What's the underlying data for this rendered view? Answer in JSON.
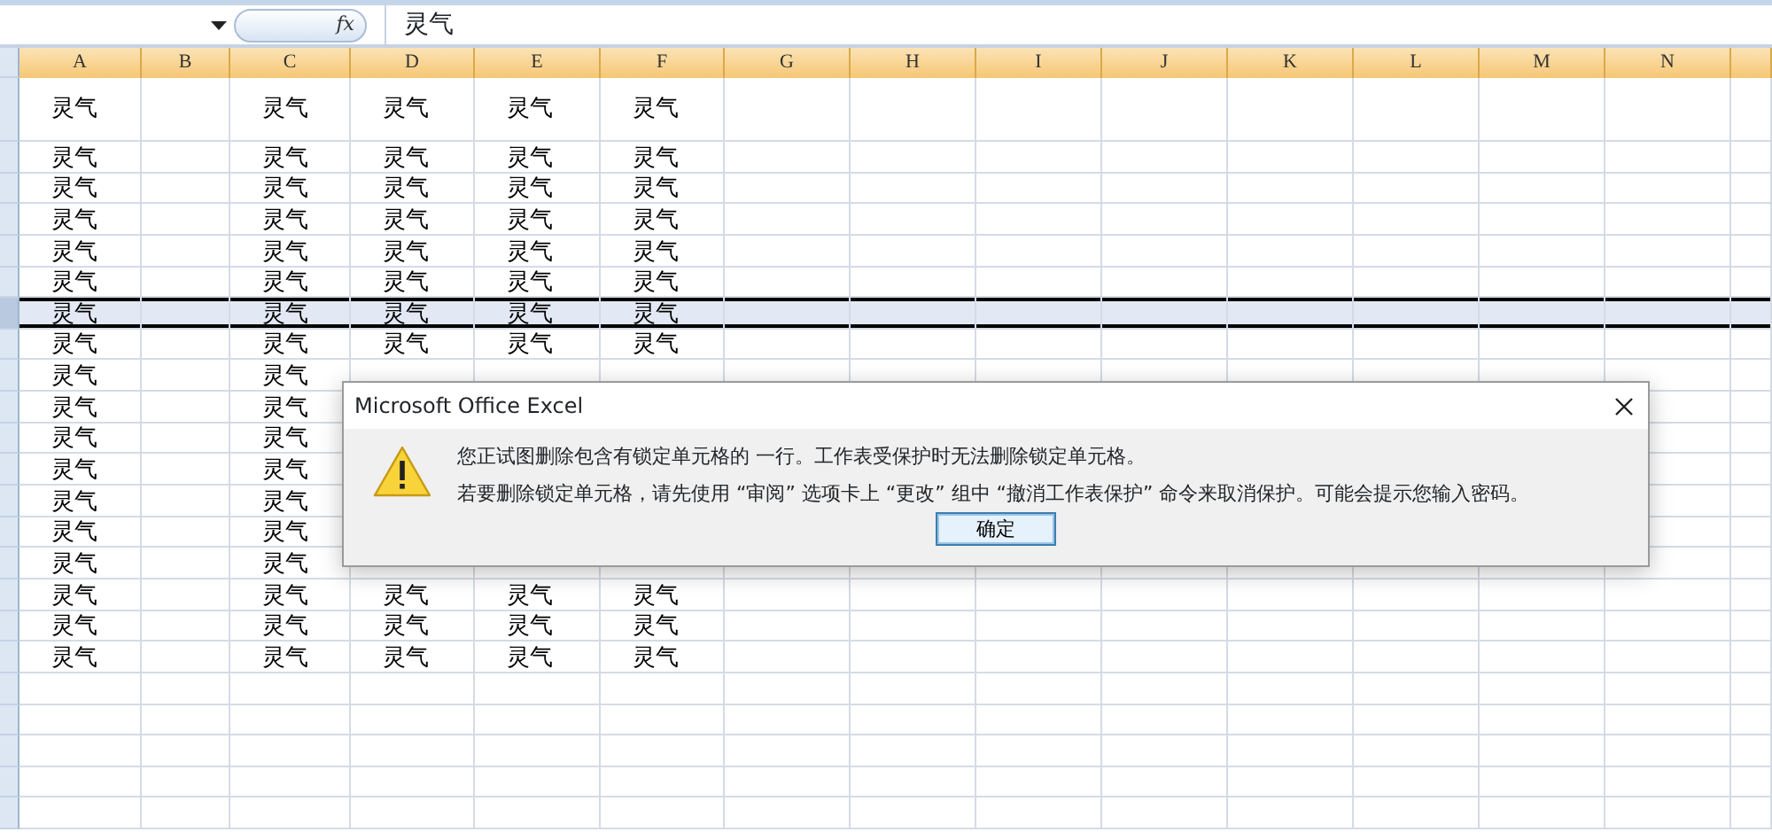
{
  "formula_bar": {
    "function_label": "fx",
    "content": "灵气"
  },
  "columns": [
    "A",
    "B",
    "C",
    "D",
    "E",
    "F",
    "G",
    "H",
    "I",
    "J",
    "K",
    "L",
    "M",
    "N"
  ],
  "rows": [
    {
      "selected": false,
      "cells": [
        "灵气",
        null,
        "灵气",
        "灵气",
        "灵气",
        "灵气"
      ]
    },
    {
      "selected": false,
      "cells": [
        "灵气",
        null,
        "灵气",
        "灵气",
        "灵气",
        "灵气"
      ]
    },
    {
      "selected": false,
      "cells": [
        "灵气",
        null,
        "灵气",
        "灵气",
        "灵气",
        "灵气"
      ]
    },
    {
      "selected": false,
      "cells": [
        "灵气",
        null,
        "灵气",
        "灵气",
        "灵气",
        "灵气"
      ]
    },
    {
      "selected": false,
      "cells": [
        "灵气",
        null,
        "灵气",
        "灵气",
        "灵气",
        "灵气"
      ]
    },
    {
      "selected": false,
      "cells": [
        "灵气",
        null,
        "灵气",
        "灵气",
        "灵气",
        "灵气"
      ]
    },
    {
      "selected": true,
      "cells": [
        "灵气",
        null,
        "灵气",
        "灵气",
        "灵气",
        "灵气"
      ]
    },
    {
      "selected": false,
      "cells": [
        "灵气",
        null,
        "灵气",
        "灵气",
        "灵气",
        "灵气"
      ]
    },
    {
      "selected": false,
      "cells": [
        "灵气",
        null,
        "灵气",
        null,
        null,
        null
      ]
    },
    {
      "selected": false,
      "cells": [
        "灵气",
        null,
        "灵气",
        null,
        null,
        null
      ]
    },
    {
      "selected": false,
      "cells": [
        "灵气",
        null,
        "灵气",
        null,
        null,
        null
      ]
    },
    {
      "selected": false,
      "cells": [
        "灵气",
        null,
        "灵气",
        null,
        null,
        null
      ]
    },
    {
      "selected": false,
      "cells": [
        "灵气",
        null,
        "灵气",
        null,
        null,
        null
      ]
    },
    {
      "selected": false,
      "cells": [
        "灵气",
        null,
        "灵气",
        null,
        null,
        null
      ]
    },
    {
      "selected": false,
      "cells": [
        "灵气",
        null,
        "灵气",
        null,
        null,
        null
      ]
    },
    {
      "selected": false,
      "cells": [
        "灵气",
        null,
        "灵气",
        "灵气",
        "灵气",
        "灵气"
      ]
    },
    {
      "selected": false,
      "cells": [
        "灵气",
        null,
        "灵气",
        "灵气",
        "灵气",
        "灵气"
      ]
    },
    {
      "selected": false,
      "cells": [
        "灵气",
        null,
        "灵气",
        "灵气",
        "灵气",
        "灵气"
      ]
    }
  ],
  "dialog": {
    "title": "Microsoft Office Excel",
    "messages": [
      "您正试图删除包含有锁定单元格的 一行。工作表受保护时无法删除锁定单元格。",
      "若要删除锁定单元格，请先使用 “审阅” 选项卡上 “更改” 组中 “撤消工作表保护” 命令来取消保护。可能会提示您输入密码。"
    ],
    "button": "确定"
  }
}
